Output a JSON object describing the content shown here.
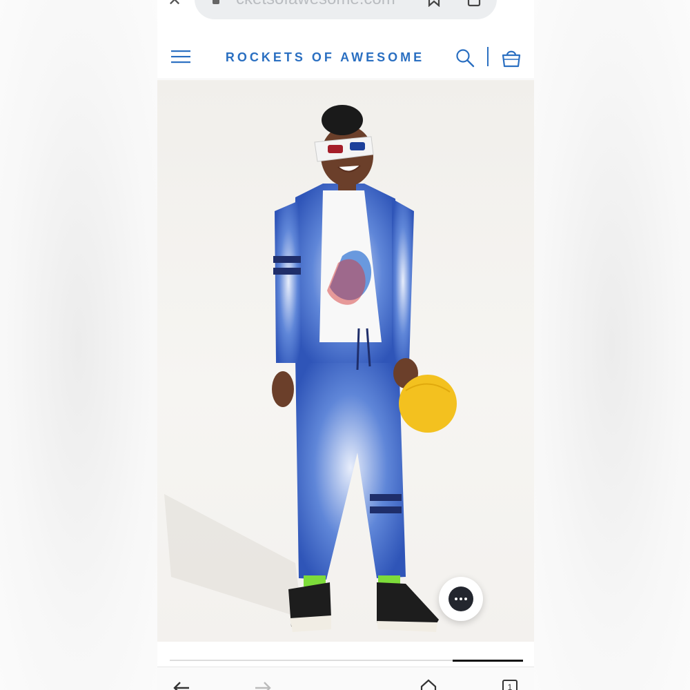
{
  "browser": {
    "url_text": "cketsofawesome.com",
    "tab_count": "1"
  },
  "header": {
    "brand": "ROCKETS OF AWESOME"
  },
  "colors": {
    "brand": "#2a6fc1",
    "chat_button": "#23262e"
  },
  "icons": {
    "close": "close-icon",
    "menu": "hamburger-menu-icon",
    "search": "search-icon",
    "bag": "shopping-bag-icon",
    "chat": "chat-bubble-icon",
    "back": "arrow-left-icon",
    "forward": "arrow-right-icon",
    "home": "home-icon",
    "tabs": "tabs-icon"
  },
  "carousel": {
    "progress_start": 0.8,
    "progress_end": 1.0
  }
}
